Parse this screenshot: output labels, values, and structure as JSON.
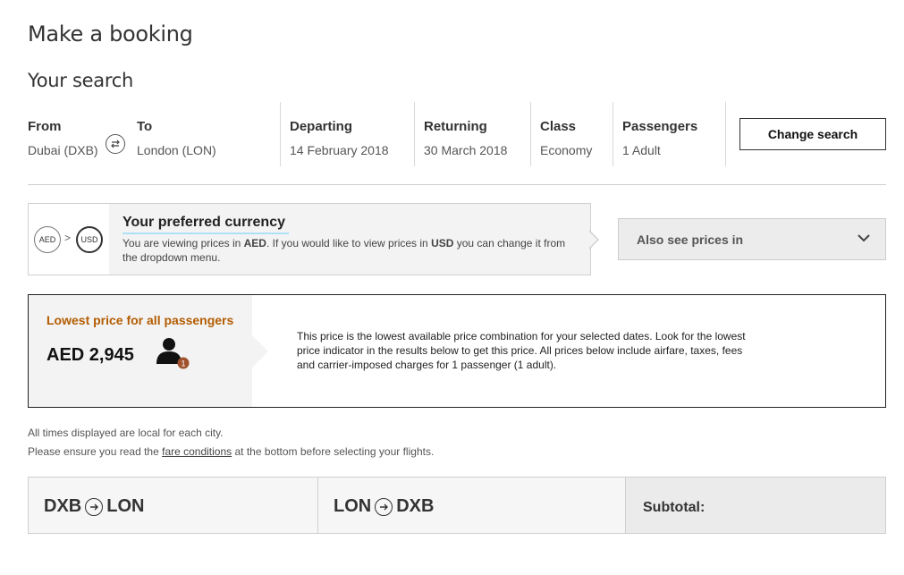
{
  "page_title": "Make a booking",
  "search": {
    "heading": "Your search",
    "from_label": "From",
    "from_value": "Dubai (DXB)",
    "to_label": "To",
    "to_value": "London (LON)",
    "departing_label": "Departing",
    "departing_value": "14 February 2018",
    "returning_label": "Returning",
    "returning_value": "30 March 2018",
    "class_label": "Class",
    "class_value": "Economy",
    "passengers_label": "Passengers",
    "passengers_value": "1 Adult",
    "change_button": "Change search"
  },
  "currency": {
    "from_code": "AED",
    "to_code": "USD",
    "separator": ">",
    "title": "Your preferred currency",
    "text_1": "You are viewing prices in ",
    "aed_bold": "AED",
    "text_2": ". If you would like to view prices in ",
    "usd_bold": "USD",
    "text_3": " you can change it from the dropdown menu.",
    "dropdown_label": "Also see prices in"
  },
  "lowest_price": {
    "title": "Lowest price for all passengers",
    "price": "AED 2,945",
    "passenger_count": "1",
    "description": "This price is the lowest available price combination for your selected dates. Look for the lowest price indicator in the results below to get this price. All prices below include airfare, taxes, fees and carrier-imposed charges for 1 passenger (1 adult)."
  },
  "notes": {
    "line1": "All times displayed are local for each city.",
    "line2_a": "Please ensure you read the ",
    "line2_link": "fare conditions",
    "line2_b": " at the bottom before selecting your flights."
  },
  "routes": {
    "outbound_from": "DXB",
    "outbound_to": "LON",
    "return_from": "LON",
    "return_to": "DXB",
    "subtotal_label": "Subtotal:"
  },
  "colors": {
    "accent_orange": "#b35c00",
    "underline_blue": "#aee0f5"
  }
}
